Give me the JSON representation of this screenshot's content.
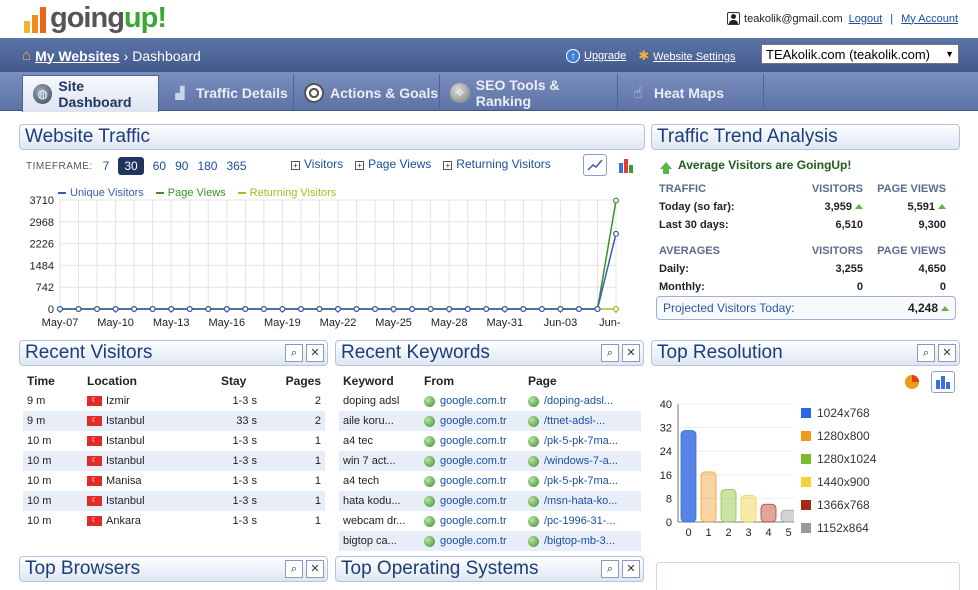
{
  "app": {
    "logo_text_part1": "going",
    "logo_text_part2": "up!"
  },
  "user": {
    "email": "teakolik@gmail.com",
    "logout": "Logout",
    "account": "My Account",
    "separator": "|"
  },
  "nav": {
    "crumb_root": "My Websites",
    "crumb_sep": "›",
    "crumb_current": "Dashboard",
    "upgrade": "Upgrade",
    "settings": "Website Settings",
    "site_selected": "TEAkolik.com (teakolik.com)"
  },
  "tabs": [
    {
      "label": "Site Dashboard",
      "icon": "globe-icon"
    },
    {
      "label": "Traffic Details",
      "icon": "bar-chart-icon"
    },
    {
      "label": "Actions & Goals",
      "icon": "target-icon"
    },
    {
      "label": "SEO Tools & Ranking",
      "icon": "compass-icon"
    },
    {
      "label": "Heat Maps",
      "icon": "cursor-icon"
    }
  ],
  "traffic": {
    "title": "Website Traffic",
    "timeframe_label": "TIMEFRAME:",
    "timeframes": [
      "7",
      "30",
      "60",
      "90",
      "180",
      "365"
    ],
    "timeframe_selected": "30",
    "toggles": [
      "Visitors",
      "Page Views",
      "Returning Visitors"
    ]
  },
  "chart_data": {
    "type": "line",
    "x": [
      "May-07",
      "May-08",
      "May-09",
      "May-10",
      "May-11",
      "May-12",
      "May-13",
      "May-14",
      "May-15",
      "May-16",
      "May-17",
      "May-18",
      "May-19",
      "May-20",
      "May-21",
      "May-22",
      "May-23",
      "May-24",
      "May-25",
      "May-26",
      "May-27",
      "May-28",
      "May-29",
      "May-30",
      "May-31",
      "Jun-01",
      "Jun-02",
      "Jun-03",
      "Jun-04",
      "Jun-05",
      "Jun-06"
    ],
    "xticks": [
      "May-07",
      "May-10",
      "May-13",
      "May-16",
      "May-19",
      "May-22",
      "May-25",
      "May-28",
      "May-31",
      "Jun-03",
      "Jun-06"
    ],
    "yticks": [
      "0",
      "742",
      "1484",
      "2226",
      "2968",
      "3710"
    ],
    "ylim": [
      0,
      3710
    ],
    "series": [
      {
        "name": "Unique Visitors",
        "color": "#3b5ea8",
        "values": [
          0,
          0,
          0,
          0,
          0,
          0,
          0,
          0,
          0,
          0,
          0,
          0,
          0,
          0,
          0,
          0,
          0,
          0,
          0,
          0,
          0,
          0,
          0,
          0,
          0,
          0,
          0,
          0,
          0,
          0,
          2560
        ]
      },
      {
        "name": "Page Views",
        "color": "#3e8e2e",
        "values": [
          0,
          0,
          0,
          0,
          0,
          0,
          0,
          0,
          0,
          0,
          0,
          0,
          0,
          0,
          0,
          0,
          0,
          0,
          0,
          0,
          0,
          0,
          0,
          0,
          0,
          0,
          0,
          0,
          0,
          0,
          3690
        ]
      },
      {
        "name": "Returning Visitors",
        "color": "#98c21e",
        "values": [
          0,
          0,
          0,
          0,
          0,
          0,
          0,
          0,
          0,
          0,
          0,
          0,
          0,
          0,
          0,
          0,
          0,
          0,
          0,
          0,
          0,
          0,
          0,
          0,
          0,
          0,
          0,
          0,
          0,
          0,
          0
        ]
      }
    ],
    "grid": true,
    "legend": "top-left"
  },
  "trend": {
    "title": "Traffic Trend Analysis",
    "goingup": "Average Visitors are GoingUp!",
    "traffic_label": "TRAFFIC",
    "visitors_label": "VISITORS",
    "pageviews_label": "PAGE VIEWS",
    "today_label": "Today (so far):",
    "today_visitors": "3,959",
    "today_pageviews": "5,591",
    "last30_label": "Last 30 days:",
    "last30_visitors": "6,510",
    "last30_pageviews": "9,300",
    "averages_label": "AVERAGES",
    "daily_label": "Daily:",
    "daily_visitors": "3,255",
    "daily_pageviews": "4,650",
    "monthly_label": "Monthly:",
    "monthly_visitors": "0",
    "monthly_pageviews": "0",
    "projected_label": "Projected Visitors Today:",
    "projected_value": "4,248"
  },
  "recent_visitors": {
    "title": "Recent Visitors",
    "headers": [
      "Time",
      "Location",
      "Stay",
      "Pages"
    ],
    "rows": [
      {
        "time": "9 m",
        "location": "Izmir",
        "stay": "1-3 s",
        "pages": "2"
      },
      {
        "time": "9 m",
        "location": "Istanbul",
        "stay": "33 s",
        "pages": "2"
      },
      {
        "time": "10 m",
        "location": "Istanbul",
        "stay": "1-3 s",
        "pages": "1"
      },
      {
        "time": "10 m",
        "location": "Istanbul",
        "stay": "1-3 s",
        "pages": "1"
      },
      {
        "time": "10 m",
        "location": "Manisa",
        "stay": "1-3 s",
        "pages": "1"
      },
      {
        "time": "10 m",
        "location": "Istanbul",
        "stay": "1-3 s",
        "pages": "1"
      },
      {
        "time": "10 m",
        "location": "Ankara",
        "stay": "1-3 s",
        "pages": "1"
      }
    ]
  },
  "recent_keywords": {
    "title": "Recent Keywords",
    "headers": [
      "Keyword",
      "From",
      "Page"
    ],
    "rows": [
      {
        "keyword": "doping adsl",
        "from": "google.com.tr",
        "page": "/doping-adsl..."
      },
      {
        "keyword": "aile koru...",
        "from": "google.com.tr",
        "page": "/ttnet-adsl-..."
      },
      {
        "keyword": "a4 tec",
        "from": "google.com.tr",
        "page": "/pk-5-pk-7ma..."
      },
      {
        "keyword": "win 7 act...",
        "from": "google.com.tr",
        "page": "/windows-7-a..."
      },
      {
        "keyword": "a4 tech",
        "from": "google.com.tr",
        "page": "/pk-5-pk-7ma..."
      },
      {
        "keyword": "hata kodu...",
        "from": "google.com.tr",
        "page": "/msn-hata-ko..."
      },
      {
        "keyword": "webcam dr...",
        "from": "google.com.tr",
        "page": "/pc-1996-31-..."
      },
      {
        "keyword": "bigtop ca...",
        "from": "google.com.tr",
        "page": "/bigtop-mb-3..."
      }
    ]
  },
  "top_resolution": {
    "title": "Top Resolution",
    "chart": {
      "type": "bar",
      "categories": [
        "0",
        "1",
        "2",
        "3",
        "4",
        "5"
      ],
      "values": [
        31,
        17,
        11,
        9,
        6,
        4
      ],
      "yticks": [
        "0",
        "8",
        "16",
        "24",
        "32",
        "40"
      ],
      "ylim": [
        0,
        40
      ],
      "colors": [
        "#3a6fe0",
        "#f0a030",
        "#8ac43a",
        "#f0d040",
        "#b83a20",
        "#a0a0a0"
      ]
    },
    "legend": [
      {
        "label": "1024x768",
        "color": "#2a66e8"
      },
      {
        "label": "1280x800",
        "color": "#f09a1a"
      },
      {
        "label": "1280x1024",
        "color": "#7dbb2c"
      },
      {
        "label": "1440x900",
        "color": "#f4d23c"
      },
      {
        "label": "1366x768",
        "color": "#a52a14"
      },
      {
        "label": "1152x864",
        "color": "#999999"
      }
    ]
  },
  "top_browsers": {
    "title": "Top Browsers"
  },
  "top_os": {
    "title": "Top Operating Systems"
  },
  "flag_glyph": "☾"
}
